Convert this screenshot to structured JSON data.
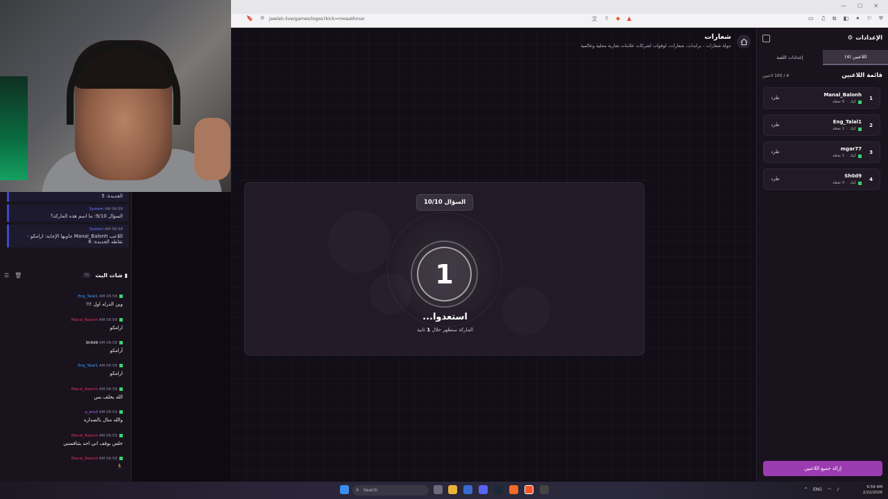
{
  "browser": {
    "url": "jawlah.live/games/logos?kick=moaathmar"
  },
  "game": {
    "title": "شعارات",
    "subtitle": "جولة شعارات - براندات، شعارات، لوقوات لشركات علامات تجارية محلية وعالمية",
    "question_badge": "السؤال 10/10",
    "countdown": "1",
    "ready_text": "استعدوا...",
    "ready_sub_prefix": "الماركة ستظهر خلال",
    "ready_sub_num": "1",
    "ready_sub_suffix": "ثانية"
  },
  "settings": {
    "title": "الإعدادات",
    "tabs": [
      {
        "label": "اللاعبين (4)",
        "active": true
      },
      {
        "label": "إعدادات اللعبة",
        "active": false
      }
    ],
    "players_title": "قائمة اللاعبين",
    "players_count": "4 / 100 لاعبين",
    "players": [
      {
        "rank": "1",
        "name": "Manal_Balonh",
        "platform": "كيك",
        "points": "6 نقطة",
        "kick": "طرد"
      },
      {
        "rank": "2",
        "name": "Eng_Talal1",
        "platform": "كيك",
        "points": "1 نقطة",
        "kick": "طرد"
      },
      {
        "rank": "3",
        "name": "mgar77",
        "platform": "كيك",
        "points": "1 نقطة",
        "kick": "طرد"
      },
      {
        "rank": "4",
        "name": "Sh0d9",
        "platform": "كيك",
        "points": "0 نقطة",
        "kick": "طرد"
      }
    ],
    "clear_button": "إزالة جميع اللاعبين"
  },
  "chat": {
    "system_messages": [
      {
        "text": "الجديدة: 5"
      },
      {
        "who": "System",
        "time": "AM 06:58",
        "text": "السؤال 9/10: ما اسم هذه الماركة؟"
      },
      {
        "who": "System",
        "time": "AM 06:58",
        "text": "اللاعب Manal_Balonh جاوبها الإجابة: ارامكو - نقاطه الجديدة: 6"
      }
    ],
    "title": "شات البث",
    "count": "31",
    "messages": [
      {
        "user": "Eng_Talal1",
        "time": "AM 06:58",
        "text": "وين الدرله اول !!!",
        "color": "#3aa0ff"
      },
      {
        "user": "Manal_Balonh",
        "time": "AM 06:58",
        "text": "ارامكو",
        "color": "#e0335a"
      },
      {
        "user": "Sh0d9",
        "time": "AM 06:58",
        "text": "أرامكو",
        "color": "#ffffff"
      },
      {
        "user": "Eng_Talal1",
        "time": "AM 06:58",
        "text": "ارامكو",
        "color": "#3aa0ff"
      },
      {
        "user": "Manal_Balonh",
        "time": "AM 06:58",
        "text": "الله يخلف بس",
        "color": "#e0335a"
      },
      {
        "user": "a_eru0",
        "time": "AM 06:59",
        "text": "والله منال بالصداره",
        "color": "#b06cff"
      },
      {
        "user": "Manal_Balonh",
        "time": "AM 06:59",
        "text": "خلص بوقف اني احد يتنافسني",
        "color": "#e0335a"
      },
      {
        "user": "Manal_Balonh",
        "time": "AM 06:58",
        "text": "🏃",
        "color": "#e0335a"
      }
    ]
  },
  "taskbar": {
    "search_placeholder": "Search",
    "lang": "ENG",
    "time": "6:59 AM",
    "date": "2/22/2026"
  }
}
